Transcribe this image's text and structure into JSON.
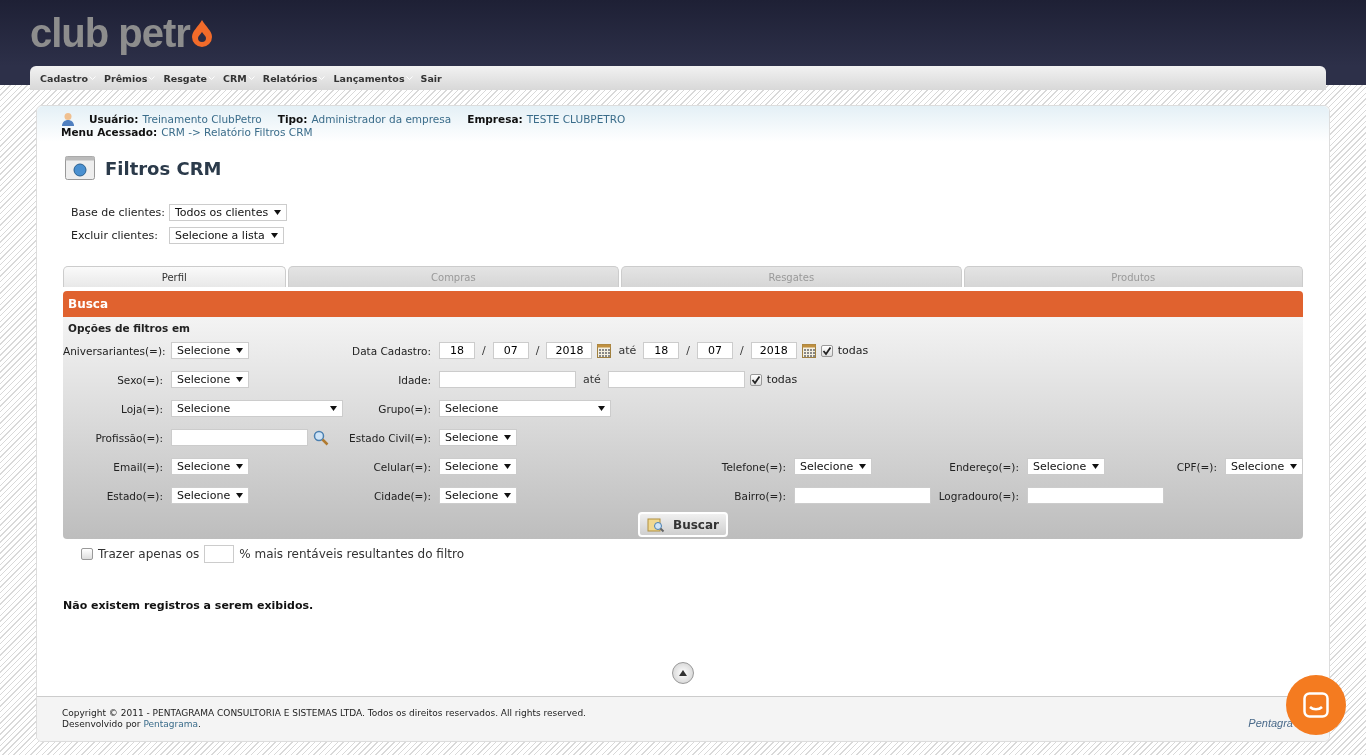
{
  "logo": {
    "text": "club petr"
  },
  "menu": [
    {
      "label": "Cadastro",
      "has_submenu": true
    },
    {
      "label": "Prêmios",
      "has_submenu": true
    },
    {
      "label": "Resgate",
      "has_submenu": true
    },
    {
      "label": "CRM",
      "has_submenu": true
    },
    {
      "label": "Relatórios",
      "has_submenu": true
    },
    {
      "label": "Lançamentos",
      "has_submenu": true
    },
    {
      "label": "Sair",
      "has_submenu": false
    }
  ],
  "session": {
    "user_label": "Usuário:",
    "user": "Treinamento ClubPetro",
    "type_label": "Tipo:",
    "type": "Administrador da empresa",
    "company_label": "Empresa:",
    "company": "TESTE CLUBPETRO",
    "menu_label": "Menu Acessado:",
    "menu_path": "CRM -> Relatório Filtros CRM"
  },
  "page_title": "Filtros CRM",
  "top_filters": [
    {
      "label": "Base de clientes:",
      "value": "Todos os clientes"
    },
    {
      "label": "Excluir clientes:",
      "value": "Selecione a lista"
    }
  ],
  "tabs": [
    {
      "label": "Perfil",
      "selected": true
    },
    {
      "label": "Compras",
      "selected": false
    },
    {
      "label": "Resgates",
      "selected": false
    },
    {
      "label": "Produtos",
      "selected": false
    }
  ],
  "panel": {
    "title": "Busca",
    "subtitle": "Opções de filtros em",
    "rows": [
      [
        {
          "label": "Aniversariantes(=):",
          "kind": "select",
          "value": "Selecione"
        },
        {
          "label": "Data Cadastro:",
          "kind": "date_range",
          "from": [
            "18",
            "07",
            "2018"
          ],
          "to": [
            "18",
            "07",
            "2018"
          ],
          "separator": "/",
          "between": "até",
          "all_label": "todas",
          "all_checked": true
        }
      ],
      [
        {
          "label": "Sexo(=):",
          "kind": "select",
          "value": "Selecione"
        },
        {
          "label": "Idade:",
          "kind": "number_range",
          "between": "até",
          "all_label": "todas",
          "all_checked": true
        }
      ],
      [
        {
          "label": "Loja(=):",
          "kind": "wide_select",
          "value": "Selecione"
        },
        {
          "label": "Grupo(=):",
          "kind": "wide_select",
          "value": "Selecione"
        }
      ],
      [
        {
          "label": "Profissão(=):",
          "kind": "lookup"
        },
        {
          "label": "Estado Civil(=):",
          "kind": "select",
          "value": "Selecione"
        }
      ],
      [
        {
          "label": "Email(=):",
          "kind": "select",
          "value": "Selecione"
        },
        {
          "label": "Celular(=):",
          "kind": "select",
          "value": "Selecione"
        },
        {
          "label": "Telefone(=):",
          "kind": "select",
          "value": "Selecione"
        },
        {
          "label": "Endereço(=):",
          "kind": "select",
          "value": "Selecione"
        },
        {
          "label": "CPF(=):",
          "kind": "select",
          "value": "Selecione"
        }
      ],
      [
        {
          "label": "Estado(=):",
          "kind": "select",
          "value": "Selecione"
        },
        {
          "label": "Cidade(=):",
          "kind": "select",
          "value": "Selecione"
        },
        {
          "label": "Bairro(=):",
          "kind": "text"
        },
        {
          "label": "Logradouro(=):",
          "kind": "text"
        }
      ]
    ],
    "button": "Buscar"
  },
  "top_percent": {
    "checked": false,
    "before": "Trazer apenas os",
    "after": "% mais rentáveis resultantes do filtro"
  },
  "empty_message": "Não existem registros a serem exibidos.",
  "footer": {
    "copyright": "Copyright © 2011 - PENTAGRAMA CONSULTORIA E SISTEMAS LTDA. Todos os direitos reservados. All rights reserved.",
    "developed_by": "Desenvolvido por",
    "developer": "Pentagrama",
    "suffix": ".",
    "logo": "Pentagra"
  }
}
